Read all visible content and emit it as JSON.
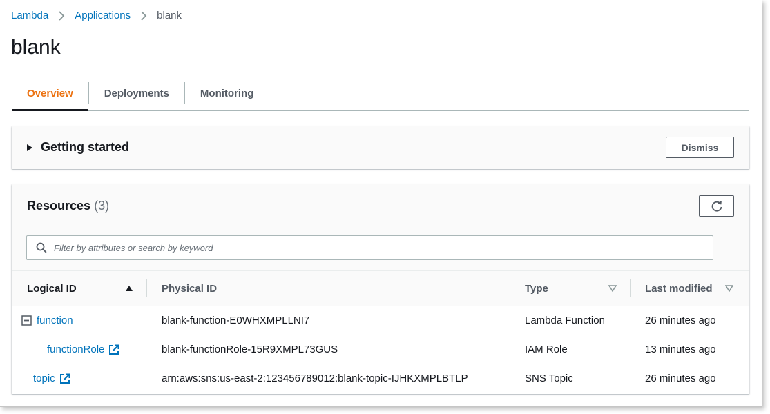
{
  "breadcrumb": {
    "items": [
      "Lambda",
      "Applications"
    ],
    "current": "blank"
  },
  "page_title": "blank",
  "tabs": [
    {
      "label": "Overview",
      "active": true
    },
    {
      "label": "Deployments",
      "active": false
    },
    {
      "label": "Monitoring",
      "active": false
    }
  ],
  "getting_started": {
    "title": "Getting started",
    "dismiss_label": "Dismiss"
  },
  "resources": {
    "title": "Resources",
    "count": "(3)",
    "search_placeholder": "Filter by attributes or search by keyword",
    "columns": [
      "Logical ID",
      "Physical ID",
      "Type",
      "Last modified"
    ],
    "rows": [
      {
        "logical_id": "function",
        "physical_id": "blank-function-E0WHXMPLLNI7",
        "type": "Lambda Function",
        "last_modified": "26 minutes ago"
      },
      {
        "logical_id": "functionRole",
        "physical_id": "blank-functionRole-15R9XMPL73GUS",
        "type": "IAM Role",
        "last_modified": "13 minutes ago"
      },
      {
        "logical_id": "topic",
        "physical_id": "arn:aws:sns:us-east-2:123456789012:blank-topic-IJHKXMPLBTLP",
        "type": "SNS Topic",
        "last_modified": "26 minutes ago"
      }
    ]
  },
  "colors": {
    "link": "#0073bb",
    "active_tab": "#ec7211",
    "text": "#16191f",
    "muted": "#545b64"
  }
}
